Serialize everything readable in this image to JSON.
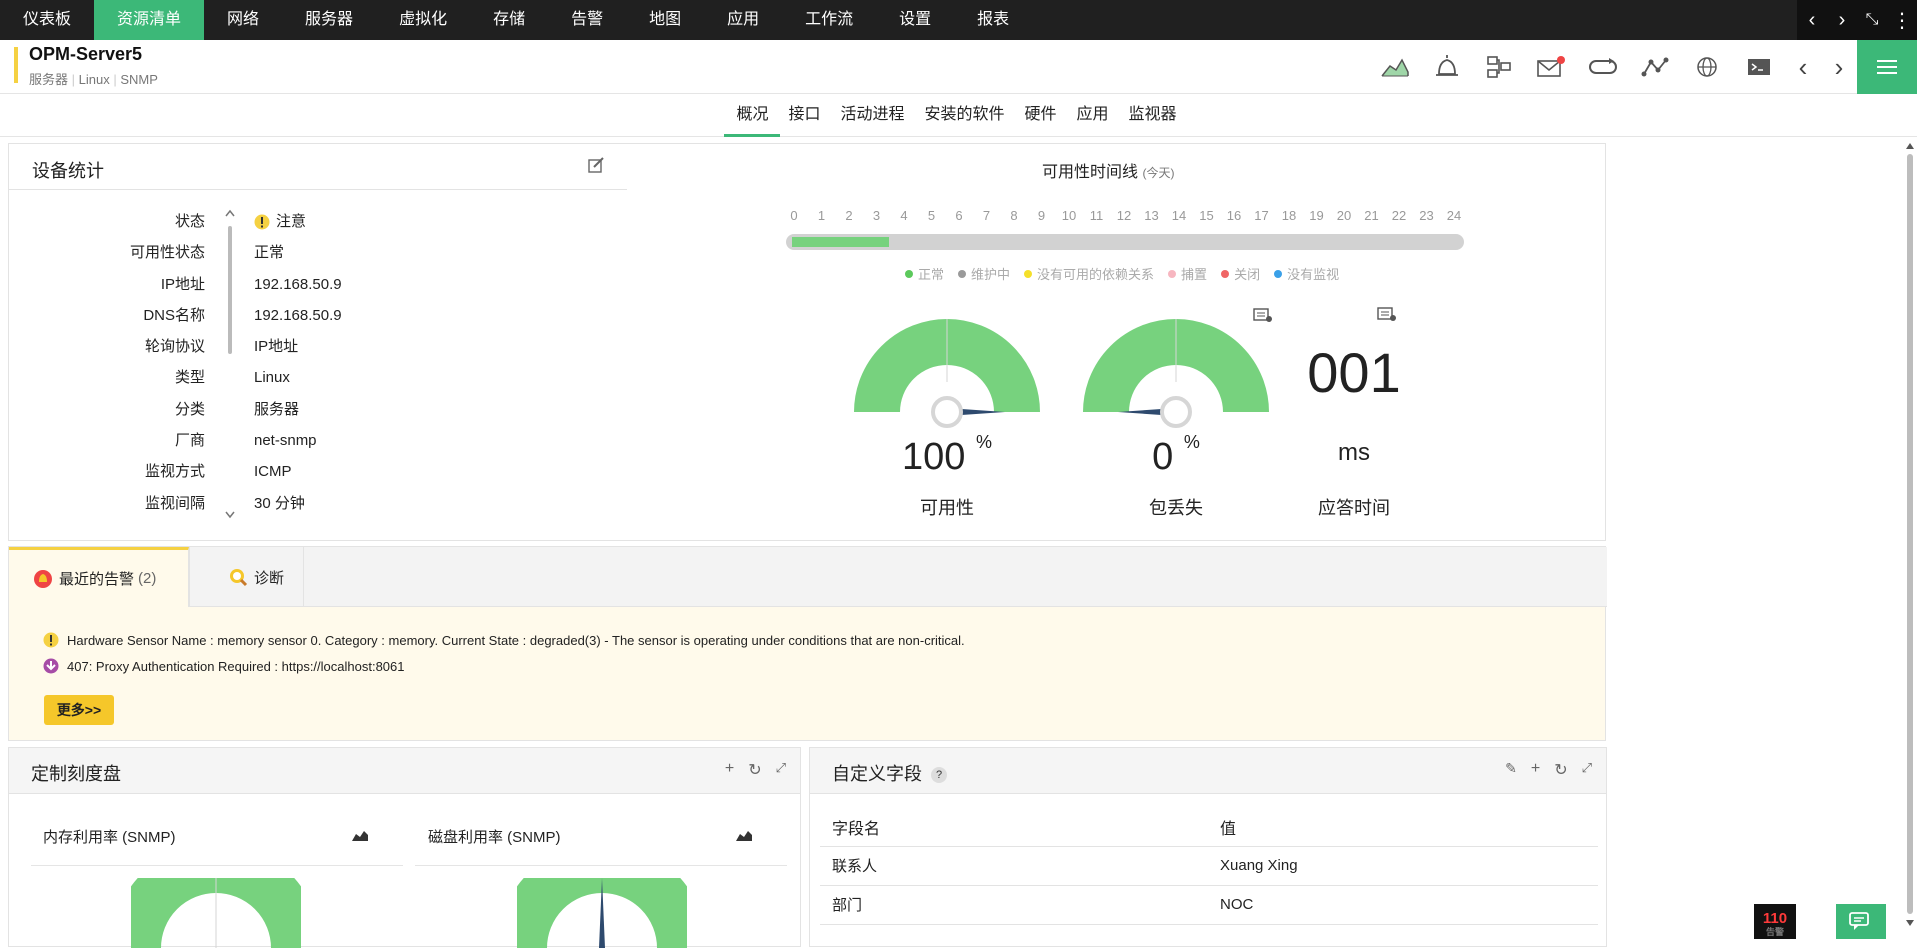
{
  "topnav": {
    "items": [
      "仪表板",
      "资源清单",
      "网络",
      "服务器",
      "虚拟化",
      "存储",
      "告警",
      "地图",
      "应用",
      "工作流",
      "设置",
      "报表"
    ],
    "active_index": 1
  },
  "header": {
    "title": "OPM-Server5",
    "breadcrumb": [
      "服务器",
      "Linux",
      "SNMP"
    ]
  },
  "tabs": {
    "items": [
      "概况",
      "接口",
      "活动进程",
      "安装的软件",
      "硬件",
      "应用",
      "监视器"
    ],
    "active_index": 0
  },
  "device_stats": {
    "title": "设备统计",
    "rows": [
      {
        "label": "状态",
        "value": "注意",
        "icon": "warning-icon"
      },
      {
        "label": "可用性状态",
        "value": "正常"
      },
      {
        "label": "IP地址",
        "value": "192.168.50.9"
      },
      {
        "label": "DNS名称",
        "value": "192.168.50.9"
      },
      {
        "label": "轮询协议",
        "value": "IP地址"
      },
      {
        "label": "类型",
        "value": "Linux"
      },
      {
        "label": "分类",
        "value": "服务器"
      },
      {
        "label": "厂商",
        "value": "net-snmp"
      },
      {
        "label": "监视方式",
        "value": "ICMP"
      },
      {
        "label": "监视间隔",
        "value": "30 分钟"
      }
    ]
  },
  "availability": {
    "title": "可用性时间线",
    "subtitle": "(今天)",
    "hours": [
      "0",
      "1",
      "2",
      "3",
      "4",
      "5",
      "6",
      "7",
      "8",
      "9",
      "10",
      "11",
      "12",
      "13",
      "14",
      "15",
      "16",
      "17",
      "18",
      "19",
      "20",
      "21",
      "22",
      "23",
      "24"
    ],
    "up_until_hour": 3.5,
    "legend": [
      {
        "label": "正常",
        "color": "#5cc95c"
      },
      {
        "label": "维护中",
        "color": "#9a9a9a"
      },
      {
        "label": "没有可用的依赖关系",
        "color": "#f5e02a"
      },
      {
        "label": "捕置",
        "color": "#f7b6c0"
      },
      {
        "label": "关闭",
        "color": "#f06666"
      },
      {
        "label": "没有监视",
        "color": "#3aa0e8"
      }
    ]
  },
  "gauges": [
    {
      "value": "100",
      "unit": "%",
      "label": "可用性",
      "percent": 100
    },
    {
      "value": "0",
      "unit": "%",
      "label": "包丢失",
      "percent": 0
    }
  ],
  "response": {
    "value": "001",
    "unit": "ms",
    "label": "应答时间"
  },
  "alerts": {
    "tab_label": "最近的告警",
    "tab_count": "(2)",
    "diag_label": "诊断",
    "items": [
      {
        "text": "Hardware Sensor Name : memory sensor 0. Category : memory. Current State : degraded(3) - The sensor is operating under conditions that are non-critical.",
        "icon": "warning-icon"
      },
      {
        "text": "407: Proxy Authentication Required : https://localhost:8061",
        "icon": "down-arrow-icon"
      }
    ],
    "more_label": "更多>>"
  },
  "custom_dial": {
    "title": "定制刻度盘",
    "items": [
      "内存利用率 (SNMP)",
      "磁盘利用率 (SNMP)"
    ]
  },
  "custom_fields": {
    "title": "自定义字段",
    "columns": [
      "字段名",
      "值"
    ],
    "rows": [
      [
        "联系人",
        "Xuang Xing"
      ],
      [
        "部门",
        "NOC"
      ]
    ]
  },
  "alarm_badge": {
    "count": "110",
    "label": "告警"
  },
  "colors": {
    "accent": "#3cb878",
    "gauge_green": "#77d27e",
    "needle": "#2e4a6e",
    "warning": "#f5c72a"
  }
}
